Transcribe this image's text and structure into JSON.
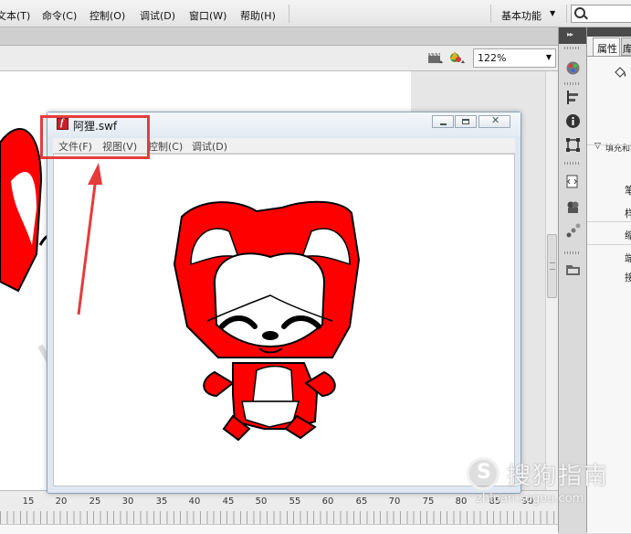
{
  "menubar": {
    "items": [
      "文本(T)",
      "命令(C)",
      "控制(O)",
      "调试(D)",
      "窗口(W)",
      "帮助(H)"
    ],
    "workspace_label": "基本功能"
  },
  "stage_toolbar": {
    "zoom": "122%"
  },
  "ruler": {
    "labels": [
      "15",
      "20",
      "25",
      "30",
      "35",
      "40",
      "45",
      "50",
      "55",
      "60",
      "65",
      "70",
      "75",
      "80",
      "85",
      "90"
    ]
  },
  "properties_panel": {
    "tab_label": "属性",
    "tab2_label": "库",
    "fill_section": "填充和笔触",
    "rows": [
      "笔",
      "样",
      "缩",
      "端",
      "接"
    ]
  },
  "swf_window": {
    "title": "阿狸.swf",
    "menu": [
      "文件(F)",
      "视图(V)",
      "控制(C)",
      "调试(D)"
    ]
  },
  "watermark": {
    "title": "搜狗指南",
    "url": "zhinan.sogou.com"
  },
  "colors": {
    "character_red": "#ff0000",
    "annotation_red": "#e63b3b"
  }
}
